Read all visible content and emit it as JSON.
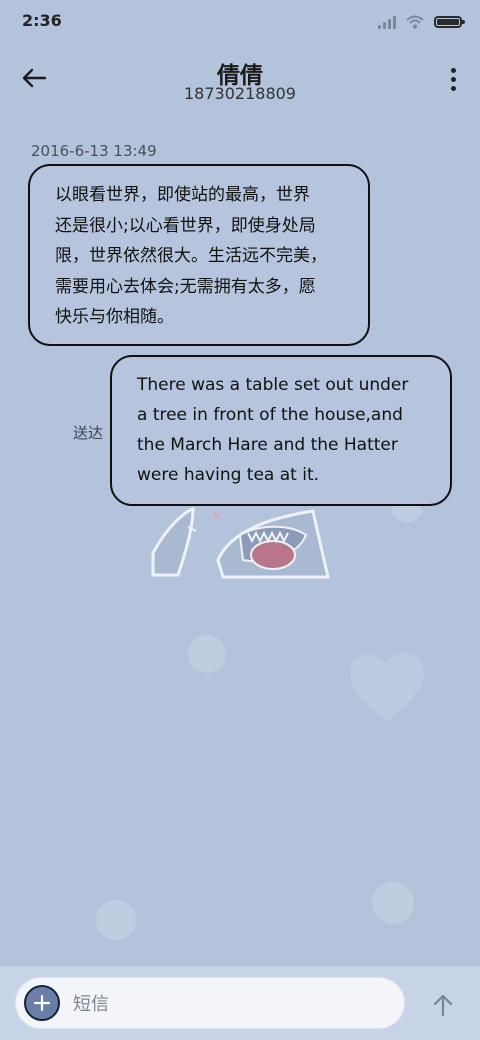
{
  "status_bar": {
    "time": "2:36",
    "battery_level": 1.0
  },
  "header": {
    "contact_name": "倩倩",
    "phone_number": "18730218809"
  },
  "messages": [
    {
      "direction": "incoming",
      "timestamp": "2016-6-13 13:49",
      "lines": [
        "以眼看世界，即使站的最高，世界",
        "还是很小;以心看世界，即使身处局",
        "限，世界依然很大。生活远不完美，",
        "需要用心去体会;无需拥有太多，愿",
        "快乐与你相随。"
      ]
    },
    {
      "direction": "outgoing",
      "status": "送达",
      "lines": [
        "There was a table set out under",
        "a tree in front of the house,and",
        "the March Hare and the Hatter",
        "were having tea at it."
      ]
    }
  ],
  "composer": {
    "placeholder": "短信"
  },
  "icons": {
    "back": "arrow-left-icon",
    "more": "more-vertical-icon",
    "add": "plus-icon",
    "send": "arrow-up-icon"
  },
  "colors": {
    "background": "#b3c3db",
    "bubble_border": "#111111",
    "composer_bg": "#c7d3e6",
    "add_button": "#6a7ea7"
  }
}
